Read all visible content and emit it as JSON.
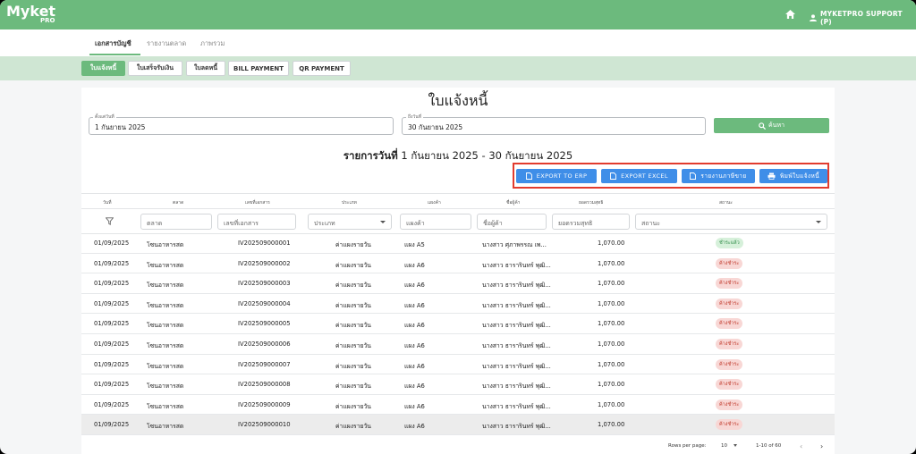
{
  "app": {
    "logo": "Myket",
    "logo_sub": "PRO",
    "user": "MYKETPRO SUPPORT (P)"
  },
  "subnav": [
    "เอกสารบัญชี",
    "รายงานตลาด",
    "ภาพรวม"
  ],
  "doc_types": [
    "ใบแจ้งหนี้",
    "ใบเสร็จรับเงิน",
    "ใบลดหนี้",
    "BILL PAYMENT",
    "QR PAYMENT"
  ],
  "page_title": "ใบแจ้งหนี้",
  "filters": {
    "start_label": "ตั้งแต่วันที่",
    "start_value": "1 กันยายน 2025",
    "end_label": "ถึงวันที่",
    "end_value": "30 กันยายน 2025",
    "search_label": "ค้นหา"
  },
  "report": {
    "prefix": "รายการวันที่",
    "range": " 1 กันยายน 2025 - 30 กันยายน 2025"
  },
  "exports": [
    "EXPORT TO ERP",
    "EXPORT EXCEL",
    "รายงานภาษีขาย",
    "พิมพ์ใบแจ้งหนี้"
  ],
  "columns": [
    "วันที่",
    "ตลาด",
    "เลขที่เอกสาร",
    "ประเภท",
    "แผงค้า",
    "ชื่อผู้ค้า",
    "ยอดรวมสุทธิ",
    "สถานะ"
  ],
  "column_filters": {
    "market": "ตลาด",
    "doc_no": "เลขที่เอกสาร",
    "type": "ประเภท",
    "stall": "แผงค้า",
    "vendor": "ชื่อผู้ค้า",
    "total": "ยอดรวมสุทธิ",
    "status": "สถานะ"
  },
  "rows": [
    {
      "date": "01/09/2025",
      "market": "โซนอาหารสด",
      "doc_no": "IV202509000001",
      "type": "ค่าแผงรายวัน",
      "stall": "แผง A5",
      "vendor": "นางสาว ศุภาพรรณ เพ...",
      "total": "1,070.00",
      "status": "ชำระแล้ว",
      "paid": true
    },
    {
      "date": "01/09/2025",
      "market": "โซนอาหารสด",
      "doc_no": "IV202509000002",
      "type": "ค่าแผงรายวัน",
      "stall": "แผง A6",
      "vendor": "นางสาว ธารารินทร์ พุฒิ...",
      "total": "1,070.00",
      "status": "ค้างชำระ",
      "paid": false
    },
    {
      "date": "01/09/2025",
      "market": "โซนอาหารสด",
      "doc_no": "IV202509000003",
      "type": "ค่าแผงรายวัน",
      "stall": "แผง A6",
      "vendor": "นางสาว ธารารินทร์ พุฒิ...",
      "total": "1,070.00",
      "status": "ค้างชำระ",
      "paid": false
    },
    {
      "date": "01/09/2025",
      "market": "โซนอาหารสด",
      "doc_no": "IV202509000004",
      "type": "ค่าแผงรายวัน",
      "stall": "แผง A6",
      "vendor": "นางสาว ธารารินทร์ พุฒิ...",
      "total": "1,070.00",
      "status": "ค้างชำระ",
      "paid": false
    },
    {
      "date": "01/09/2025",
      "market": "โซนอาหารสด",
      "doc_no": "IV202509000005",
      "type": "ค่าแผงรายวัน",
      "stall": "แผง A6",
      "vendor": "นางสาว ธารารินทร์ พุฒิ...",
      "total": "1,070.00",
      "status": "ค้างชำระ",
      "paid": false
    },
    {
      "date": "01/09/2025",
      "market": "โซนอาหารสด",
      "doc_no": "IV202509000006",
      "type": "ค่าแผงรายวัน",
      "stall": "แผง A6",
      "vendor": "นางสาว ธารารินทร์ พุฒิ...",
      "total": "1,070.00",
      "status": "ค้างชำระ",
      "paid": false
    },
    {
      "date": "01/09/2025",
      "market": "โซนอาหารสด",
      "doc_no": "IV202509000007",
      "type": "ค่าแผงรายวัน",
      "stall": "แผง A6",
      "vendor": "นางสาว ธารารินทร์ พุฒิ...",
      "total": "1,070.00",
      "status": "ค้างชำระ",
      "paid": false
    },
    {
      "date": "01/09/2025",
      "market": "โซนอาหารสด",
      "doc_no": "IV202509000008",
      "type": "ค่าแผงรายวัน",
      "stall": "แผง A6",
      "vendor": "นางสาว ธารารินทร์ พุฒิ...",
      "total": "1,070.00",
      "status": "ค้างชำระ",
      "paid": false
    },
    {
      "date": "01/09/2025",
      "market": "โซนอาหารสด",
      "doc_no": "IV202509000009",
      "type": "ค่าแผงรายวัน",
      "stall": "แผง A6",
      "vendor": "นางสาว ธารารินทร์ พุฒิ...",
      "total": "1,070.00",
      "status": "ค้างชำระ",
      "paid": false
    },
    {
      "date": "01/09/2025",
      "market": "โซนอาหารสด",
      "doc_no": "IV202509000010",
      "type": "ค่าแผงรายวัน",
      "stall": "แผง A6",
      "vendor": "นางสาว ธารารินทร์ พุฒิ...",
      "total": "1,070.00",
      "status": "ค้างชำระ",
      "paid": false
    }
  ],
  "pagination": {
    "rows_label": "Rows per page:",
    "rows_value": "10",
    "range": "1-10 of 60"
  },
  "colors": {
    "brand": "#6cba7d",
    "export": "#3f8ee8",
    "highlight_box": "#e23b2e",
    "paid_bg": "#d6f0da",
    "unpaid_bg": "#f8d7d5"
  }
}
